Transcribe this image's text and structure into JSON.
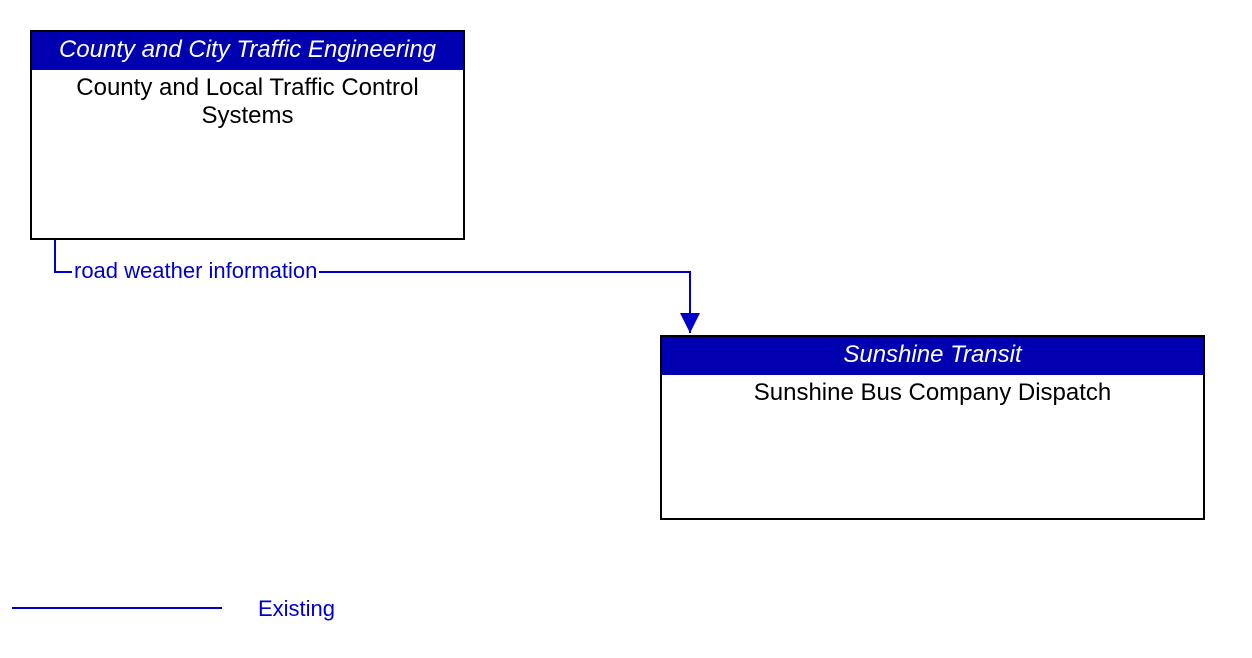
{
  "colors": {
    "header_bg": "#0000b0",
    "line": "#0000cc"
  },
  "box1": {
    "header": "County and City Traffic Engineering",
    "body": "County and Local Traffic Control Systems"
  },
  "box2": {
    "header": "Sunshine Transit",
    "body": "Sunshine Bus Company Dispatch"
  },
  "flow": {
    "label": "road weather information"
  },
  "legend": {
    "label": "Existing"
  }
}
